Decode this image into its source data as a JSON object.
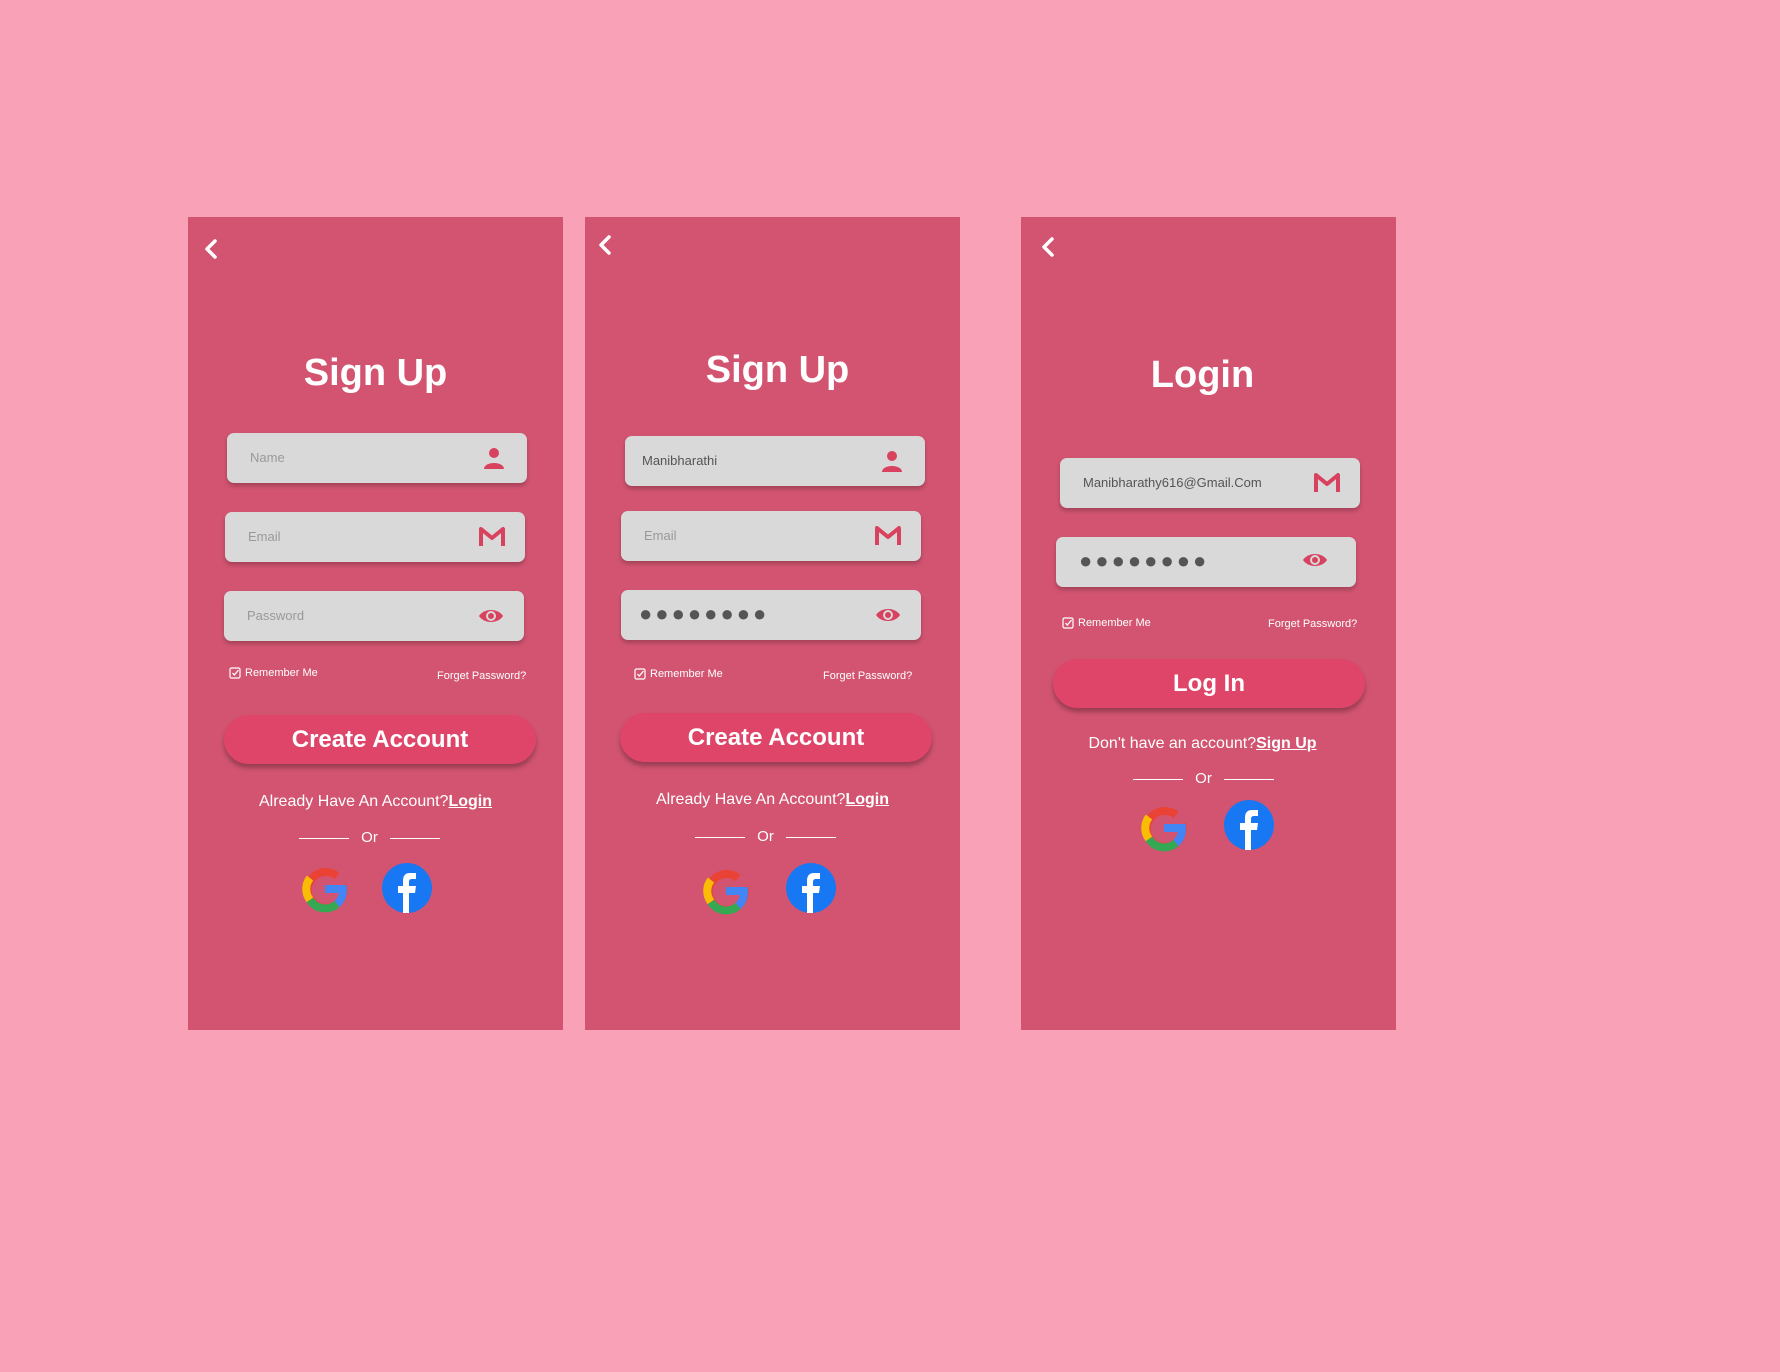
{
  "colors": {
    "background": "#f9a1b6",
    "screen": "#d25471",
    "field": "#d9d9d9",
    "accent": "#de4569",
    "facebook": "#1877f2"
  },
  "screens": [
    {
      "title": "Sign Up",
      "fields": [
        {
          "text": "Name",
          "icon": "user-icon",
          "filled": false
        },
        {
          "text": "Email",
          "icon": "gmail-icon",
          "filled": false
        },
        {
          "text": "Password",
          "icon": "eye-icon",
          "filled": false
        }
      ],
      "remember": "Remember Me",
      "forgot": "Forget Password?",
      "button": "Create Account",
      "switch_text": "Already Have An Account?",
      "switch_link": "Login",
      "or": "Or"
    },
    {
      "title": "Sign Up",
      "fields": [
        {
          "text": "Manibharathi",
          "icon": "user-icon",
          "filled": true
        },
        {
          "text": "Email",
          "icon": "gmail-icon",
          "filled": false
        },
        {
          "text": "●●●●●●●●",
          "icon": "eye-icon",
          "filled": true
        }
      ],
      "remember": "Remember Me",
      "forgot": "Forget Password?",
      "button": "Create Account",
      "switch_text": "Already Have An Account?",
      "switch_link": "Login",
      "or": "Or"
    },
    {
      "title": "Login",
      "fields": [
        {
          "text": "Manibharathy616@Gmail.Com",
          "icon": "gmail-icon",
          "filled": true
        },
        {
          "text": "●●●●●●●●",
          "icon": "eye-icon",
          "filled": true
        }
      ],
      "remember": "Remember Me",
      "forgot": "Forget Password?",
      "button": "Log In",
      "switch_text": "Don't have an account?",
      "switch_link": "Sign Up",
      "or": "Or"
    }
  ]
}
